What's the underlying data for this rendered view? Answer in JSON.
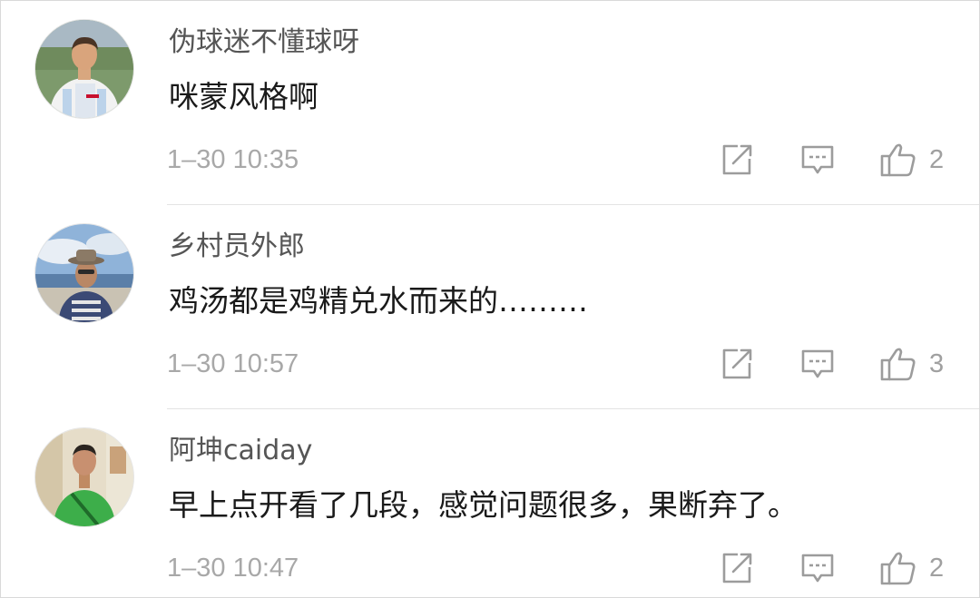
{
  "comments": [
    {
      "username": "伪球迷不懂球呀",
      "text": "咪蒙风格啊",
      "time": "1–30 10:35",
      "likes": "2",
      "avatar_icon": "soccer-player-photo"
    },
    {
      "username": "乡村员外郎",
      "text": "鸡汤都是鸡精兑水而来的………",
      "time": "1–30 10:57",
      "likes": "3",
      "avatar_icon": "man-with-hat-beach-photo"
    },
    {
      "username": "阿坤caiday",
      "text": "早上点开看了几段，感觉问题很多，果断弃了。",
      "time": "1–30 10:47",
      "likes": "2",
      "avatar_icon": "man-green-shirt-photo"
    }
  ],
  "icons": {
    "forward": "forward-icon",
    "reply": "reply-icon",
    "like": "thumbs-up-icon"
  },
  "colors": {
    "text": "#1a1a1a",
    "username": "#555555",
    "meta": "#a8a8a8",
    "icon": "#a0a0a0",
    "divider": "#e3e3e3"
  }
}
